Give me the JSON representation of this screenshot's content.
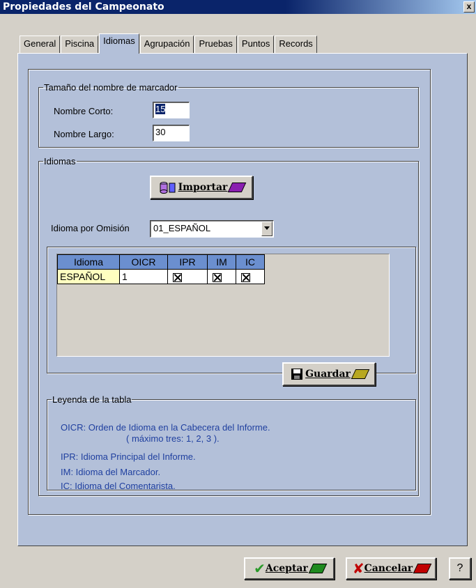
{
  "window": {
    "title": "Propiedades del Campeonato",
    "close": "x"
  },
  "tabs": [
    "General",
    "Piscina",
    "Idiomas",
    "Agrupación",
    "Pruebas",
    "Puntos",
    "Records"
  ],
  "marker_group": {
    "legend": "Tamaño del nombre de marcador",
    "short_label": "Nombre Corto:",
    "short_value": "15",
    "long_label": "Nombre Largo:",
    "long_value": "30"
  },
  "languages_group": {
    "legend": "Idiomas",
    "import_button": "Importar",
    "default_label": "Idioma por Omisión",
    "default_value": "01_ESPAÑOL"
  },
  "table": {
    "headers": [
      "Idioma",
      "OICR",
      "IPR",
      "IM",
      "IC"
    ],
    "rows": [
      {
        "idioma": "ESPAÑOL",
        "oicr": "1",
        "ipr": true,
        "im": true,
        "ic": true
      }
    ]
  },
  "save_button": "Guardar",
  "table_legend": {
    "legend": "Leyenda de la tabla",
    "line1": "OICR: Orden de Idioma en la Cabecera del Informe.",
    "line2": "( máximo tres: 1, 2, 3 ).",
    "line3": "IPR: Idioma Principal del Informe.",
    "line4": "IM: Idioma del Marcador.",
    "line5": "IC: Idioma del Comentarista."
  },
  "footer": {
    "accept": "Aceptar",
    "cancel": "Cancelar",
    "help": "?"
  },
  "colors": {
    "panel_bg": "#b3c0d9",
    "title_bar": "#0a246a",
    "grid_header": "#6b8fcf",
    "legend_text": "#1f3f9f"
  }
}
